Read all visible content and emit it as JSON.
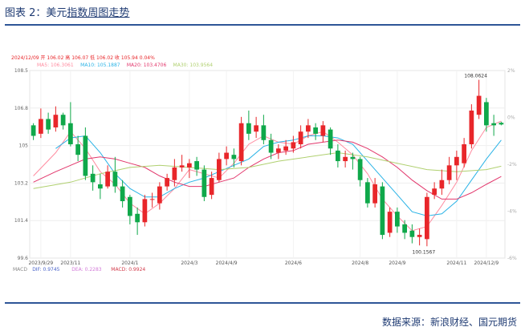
{
  "header": {
    "prefix": "图表 2：美元",
    "underlined": "指数周图走势"
  },
  "footer": {
    "source": "数据来源：新浪财经、国元期货"
  },
  "colors": {
    "up": "#e8262a",
    "down": "#0fa84a",
    "ma5": "#ff8ca0",
    "ma10": "#2ab3e6",
    "ma20": "#e2376c",
    "ma30": "#b0d070",
    "header_line": "#2e5597"
  },
  "chart_data": {
    "type": "candlestick",
    "info_line": "2024/12/09 开 106.02 高 106.07 低 106.02 收 105.94 0.04%",
    "ma_legend": [
      "MA5: 106.3061",
      "MA10: 105.1887",
      "MA20: 103.4706",
      "MA30: 103.9564"
    ],
    "macd_legend": [
      "MACD",
      "DIF: 0.9745",
      "DEA: 0.2283",
      "MACD: 0.9924"
    ],
    "ylim": [
      99.6,
      108.5
    ],
    "y_ticks": [
      "108.5",
      "106.8",
      "105",
      "103.2",
      "101.4",
      "99.6"
    ],
    "right_ticks": [
      "2%",
      "0%",
      "-2%",
      "-4%",
      "-6%"
    ],
    "x_ticks": [
      {
        "i": 1,
        "label": "2023/9/29"
      },
      {
        "i": 5,
        "label": "2023/11"
      },
      {
        "i": 13,
        "label": "2024/1"
      },
      {
        "i": 21,
        "label": "2024/3"
      },
      {
        "i": 26,
        "label": "2024/4/9"
      },
      {
        "i": 35,
        "label": "2024/6"
      },
      {
        "i": 44,
        "label": "2024/8"
      },
      {
        "i": 49,
        "label": "2024/9"
      },
      {
        "i": 57,
        "label": "2024/11"
      },
      {
        "i": 61,
        "label": "2024/12/9"
      }
    ],
    "annotations": [
      {
        "i": 60,
        "value": 108.0624,
        "label": "108.0624"
      },
      {
        "i": 53,
        "value": 100.1567,
        "label": "100.1567"
      }
    ],
    "candles": [
      {
        "o": 105.9,
        "c": 105.4,
        "h": 106.0,
        "l": 105.2
      },
      {
        "o": 105.5,
        "c": 106.2,
        "h": 106.7,
        "l": 105.3
      },
      {
        "o": 106.2,
        "c": 105.7,
        "h": 106.5,
        "l": 105.5
      },
      {
        "o": 105.8,
        "c": 106.4,
        "h": 106.8,
        "l": 105.6
      },
      {
        "o": 106.4,
        "c": 105.9,
        "h": 106.5,
        "l": 105.7
      },
      {
        "o": 106.0,
        "c": 105.0,
        "h": 107.0,
        "l": 104.9
      },
      {
        "o": 105.0,
        "c": 104.5,
        "h": 105.4,
        "l": 104.2
      },
      {
        "o": 105.4,
        "c": 103.5,
        "h": 105.8,
        "l": 103.3
      },
      {
        "o": 103.6,
        "c": 103.2,
        "h": 104.0,
        "l": 102.8
      },
      {
        "o": 103.1,
        "c": 102.9,
        "h": 103.6,
        "l": 102.4
      },
      {
        "o": 103.0,
        "c": 103.7,
        "h": 104.0,
        "l": 102.9
      },
      {
        "o": 103.7,
        "c": 103.0,
        "h": 104.4,
        "l": 102.7
      },
      {
        "o": 103.0,
        "c": 102.3,
        "h": 103.3,
        "l": 102.0
      },
      {
        "o": 102.5,
        "c": 101.6,
        "h": 102.6,
        "l": 101.2
      },
      {
        "o": 101.7,
        "c": 101.3,
        "h": 102.0,
        "l": 100.7
      },
      {
        "o": 101.3,
        "c": 102.4,
        "h": 102.6,
        "l": 101.1
      },
      {
        "o": 102.4,
        "c": 102.4,
        "h": 102.7,
        "l": 102.0
      },
      {
        "o": 102.2,
        "c": 103.0,
        "h": 103.2,
        "l": 101.9
      },
      {
        "o": 103.0,
        "c": 103.4,
        "h": 103.6,
        "l": 102.8
      },
      {
        "o": 103.3,
        "c": 103.9,
        "h": 104.3,
        "l": 103.0
      },
      {
        "o": 103.9,
        "c": 104.0,
        "h": 104.5,
        "l": 103.7
      },
      {
        "o": 103.9,
        "c": 104.1,
        "h": 104.3,
        "l": 103.4
      },
      {
        "o": 104.2,
        "c": 103.8,
        "h": 104.4,
        "l": 103.5
      },
      {
        "o": 103.8,
        "c": 102.5,
        "h": 104.0,
        "l": 102.3
      },
      {
        "o": 102.6,
        "c": 103.4,
        "h": 103.7,
        "l": 102.4
      },
      {
        "o": 103.3,
        "c": 104.3,
        "h": 104.6,
        "l": 103.2
      },
      {
        "o": 104.3,
        "c": 104.6,
        "h": 104.9,
        "l": 104.0
      },
      {
        "o": 104.5,
        "c": 104.3,
        "h": 104.8,
        "l": 103.9
      },
      {
        "o": 104.2,
        "c": 106.0,
        "h": 106.3,
        "l": 104.0
      },
      {
        "o": 106.0,
        "c": 105.5,
        "h": 106.6,
        "l": 105.2
      },
      {
        "o": 105.6,
        "c": 105.9,
        "h": 106.3,
        "l": 105.3
      },
      {
        "o": 105.9,
        "c": 105.2,
        "h": 106.4,
        "l": 105.0
      },
      {
        "o": 105.2,
        "c": 104.6,
        "h": 105.5,
        "l": 104.3
      },
      {
        "o": 104.6,
        "c": 104.8,
        "h": 105.0,
        "l": 104.3
      },
      {
        "o": 104.7,
        "c": 104.9,
        "h": 105.2,
        "l": 104.5
      },
      {
        "o": 104.8,
        "c": 105.1,
        "h": 105.4,
        "l": 104.6
      },
      {
        "o": 105.0,
        "c": 105.6,
        "h": 105.9,
        "l": 104.8
      },
      {
        "o": 105.6,
        "c": 105.9,
        "h": 106.2,
        "l": 105.3
      },
      {
        "o": 105.8,
        "c": 105.5,
        "h": 106.0,
        "l": 105.2
      },
      {
        "o": 105.4,
        "c": 105.9,
        "h": 106.1,
        "l": 105.1
      },
      {
        "o": 105.7,
        "c": 104.8,
        "h": 105.8,
        "l": 104.5
      },
      {
        "o": 104.7,
        "c": 104.2,
        "h": 105.0,
        "l": 103.9
      },
      {
        "o": 104.2,
        "c": 104.4,
        "h": 104.7,
        "l": 103.9
      },
      {
        "o": 104.4,
        "c": 104.3,
        "h": 104.6,
        "l": 103.8
      },
      {
        "o": 104.3,
        "c": 103.3,
        "h": 104.4,
        "l": 103.0
      },
      {
        "o": 103.2,
        "c": 102.2,
        "h": 103.4,
        "l": 102.0
      },
      {
        "o": 102.2,
        "c": 103.1,
        "h": 103.4,
        "l": 102.0
      },
      {
        "o": 103.0,
        "c": 100.7,
        "h": 103.2,
        "l": 100.5
      },
      {
        "o": 100.8,
        "c": 101.8,
        "h": 102.0,
        "l": 100.6
      },
      {
        "o": 101.8,
        "c": 101.1,
        "h": 102.0,
        "l": 100.8
      },
      {
        "o": 101.2,
        "c": 100.8,
        "h": 101.4,
        "l": 100.5
      },
      {
        "o": 100.9,
        "c": 100.6,
        "h": 101.2,
        "l": 100.3
      },
      {
        "o": 100.6,
        "c": 100.7,
        "h": 101.0,
        "l": 100.2
      },
      {
        "o": 100.5,
        "c": 102.5,
        "h": 102.7,
        "l": 100.16
      },
      {
        "o": 102.6,
        "c": 102.9,
        "h": 103.2,
        "l": 102.4
      },
      {
        "o": 102.9,
        "c": 103.3,
        "h": 103.8,
        "l": 102.6
      },
      {
        "o": 103.3,
        "c": 104.0,
        "h": 104.4,
        "l": 103.1
      },
      {
        "o": 104.0,
        "c": 104.4,
        "h": 104.7,
        "l": 103.3
      },
      {
        "o": 104.1,
        "c": 105.0,
        "h": 105.3,
        "l": 103.9
      },
      {
        "o": 105.0,
        "c": 106.6,
        "h": 106.9,
        "l": 104.8
      },
      {
        "o": 106.4,
        "c": 107.3,
        "h": 108.06,
        "l": 106.2
      },
      {
        "o": 107.0,
        "c": 105.9,
        "h": 107.2,
        "l": 105.6
      },
      {
        "o": 106.0,
        "c": 105.9,
        "h": 106.4,
        "l": 105.4
      },
      {
        "o": 106.02,
        "c": 105.94,
        "h": 106.07,
        "l": 105.9
      }
    ],
    "ma_series": [
      {
        "name": "MA5",
        "key": "ma5",
        "points": [
          [
            0,
            103.5
          ],
          [
            3,
            104.6
          ],
          [
            5,
            105.6
          ],
          [
            7,
            104.8
          ],
          [
            9,
            103.7
          ],
          [
            11,
            103.1
          ],
          [
            13,
            102.2
          ],
          [
            15,
            101.7
          ],
          [
            17,
            102.2
          ],
          [
            19,
            102.9
          ],
          [
            21,
            103.8
          ],
          [
            23,
            103.6
          ],
          [
            25,
            103.4
          ],
          [
            27,
            104.1
          ],
          [
            29,
            105.0
          ],
          [
            31,
            105.4
          ],
          [
            33,
            105.1
          ],
          [
            35,
            105.0
          ],
          [
            37,
            105.4
          ],
          [
            39,
            105.6
          ],
          [
            41,
            105.1
          ],
          [
            43,
            104.5
          ],
          [
            45,
            103.6
          ],
          [
            47,
            102.4
          ],
          [
            49,
            101.6
          ],
          [
            51,
            100.9
          ],
          [
            53,
            101.1
          ],
          [
            55,
            102.1
          ],
          [
            57,
            103.2
          ],
          [
            59,
            104.7
          ],
          [
            61,
            105.8
          ],
          [
            63,
            106.1
          ]
        ]
      },
      {
        "name": "MA10",
        "key": "ma10",
        "points": [
          [
            3,
            104.8
          ],
          [
            5,
            105.3
          ],
          [
            7,
            105.4
          ],
          [
            9,
            104.6
          ],
          [
            11,
            103.6
          ],
          [
            13,
            102.9
          ],
          [
            15,
            102.5
          ],
          [
            17,
            102.5
          ],
          [
            19,
            102.9
          ],
          [
            21,
            103.2
          ],
          [
            23,
            103.4
          ],
          [
            25,
            103.7
          ],
          [
            27,
            104.0
          ],
          [
            29,
            104.3
          ],
          [
            31,
            104.9
          ],
          [
            33,
            105.1
          ],
          [
            35,
            105.2
          ],
          [
            37,
            105.4
          ],
          [
            39,
            105.4
          ],
          [
            41,
            105.3
          ],
          [
            43,
            105.0
          ],
          [
            45,
            104.2
          ],
          [
            47,
            103.4
          ],
          [
            49,
            102.6
          ],
          [
            51,
            101.8
          ],
          [
            53,
            101.6
          ],
          [
            55,
            101.7
          ],
          [
            57,
            102.3
          ],
          [
            59,
            103.3
          ],
          [
            61,
            104.3
          ],
          [
            63,
            105.2
          ]
        ]
      },
      {
        "name": "MA20",
        "key": "ma20",
        "points": [
          [
            0,
            103.2
          ],
          [
            3,
            103.7
          ],
          [
            5,
            104.0
          ],
          [
            7,
            104.3
          ],
          [
            9,
            104.4
          ],
          [
            11,
            104.3
          ],
          [
            13,
            104.1
          ],
          [
            15,
            103.9
          ],
          [
            17,
            103.5
          ],
          [
            19,
            103.2
          ],
          [
            21,
            103.0
          ],
          [
            23,
            103.0
          ],
          [
            25,
            103.2
          ],
          [
            27,
            103.4
          ],
          [
            29,
            103.9
          ],
          [
            31,
            104.3
          ],
          [
            33,
            104.6
          ],
          [
            35,
            104.7
          ],
          [
            37,
            105.0
          ],
          [
            39,
            105.1
          ],
          [
            41,
            105.2
          ],
          [
            43,
            105.1
          ],
          [
            45,
            104.8
          ],
          [
            47,
            104.4
          ],
          [
            49,
            103.9
          ],
          [
            51,
            103.3
          ],
          [
            53,
            102.8
          ],
          [
            55,
            102.4
          ],
          [
            57,
            102.4
          ],
          [
            59,
            102.7
          ],
          [
            61,
            103.1
          ],
          [
            63,
            103.47
          ]
        ]
      },
      {
        "name": "MA30",
        "key": "ma30",
        "points": [
          [
            0,
            102.9
          ],
          [
            5,
            103.2
          ],
          [
            9,
            103.6
          ],
          [
            13,
            103.9
          ],
          [
            17,
            104.0
          ],
          [
            21,
            103.9
          ],
          [
            25,
            103.8
          ],
          [
            29,
            103.9
          ],
          [
            33,
            104.2
          ],
          [
            37,
            104.4
          ],
          [
            41,
            104.6
          ],
          [
            45,
            104.4
          ],
          [
            49,
            104.1
          ],
          [
            53,
            103.8
          ],
          [
            57,
            103.7
          ],
          [
            61,
            103.8
          ],
          [
            63,
            103.96
          ]
        ]
      }
    ]
  }
}
